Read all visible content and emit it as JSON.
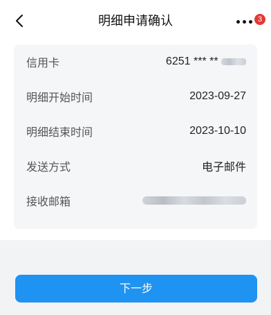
{
  "header": {
    "title": "明细申请确认",
    "badge_count": "3",
    "back_icon": "chevron-left-icon",
    "more_icon": "more-dots-icon"
  },
  "details": [
    {
      "label": "信用卡",
      "value": "6251 *** **"
    },
    {
      "label": "明细开始时间",
      "value": "2023-09-27"
    },
    {
      "label": "明细结束时间",
      "value": "2023-10-10"
    },
    {
      "label": "发送方式",
      "value": "电子邮件"
    },
    {
      "label": "接收邮箱",
      "value": ""
    }
  ],
  "actions": {
    "next_label": "下一步"
  },
  "colors": {
    "primary": "#1f93f2",
    "badge": "#e53935",
    "card_bg": "#f5f6f8",
    "page_bg": "#f2f3f5"
  }
}
